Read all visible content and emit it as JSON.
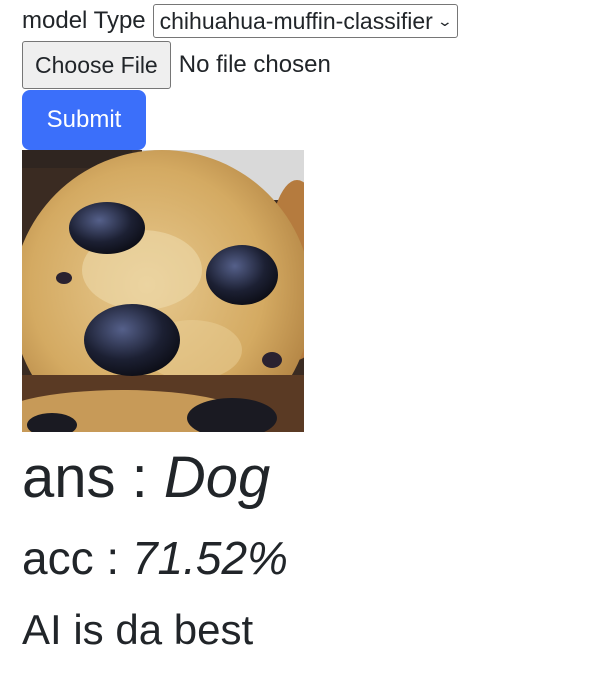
{
  "form": {
    "model_label": "model Type",
    "model_selected": "chihuahua-muffin-classifier",
    "file_button_label": "Choose File",
    "file_status": "No file chosen",
    "submit_label": "Submit"
  },
  "result": {
    "answer_label": "ans :",
    "answer_value": "Dog",
    "accuracy_label": "acc :",
    "accuracy_value": "71.52%",
    "tagline": "AI is da best"
  },
  "icons": {
    "select_chevron": "chevron-down-icon"
  },
  "colors": {
    "submit_bg": "#3b6ffa",
    "text": "#212529"
  }
}
